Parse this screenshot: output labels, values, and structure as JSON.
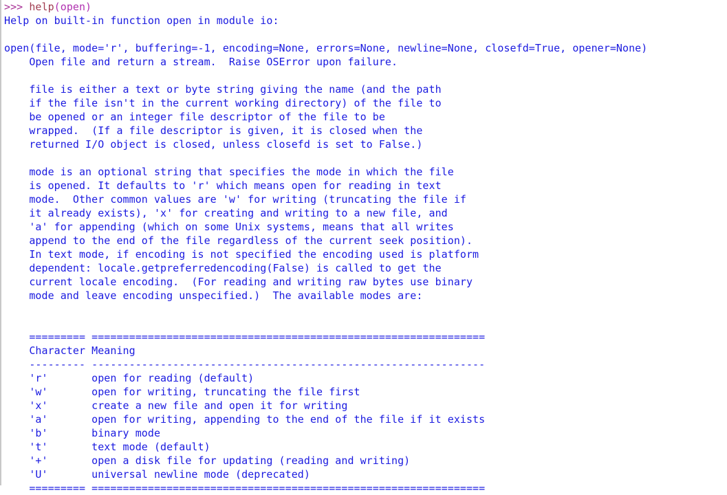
{
  "window": {
    "kind": "python-repl-console",
    "background_color": "#ffffff",
    "text_color": "#1a1ae0",
    "prompt_color": "#a83296",
    "builtin_color": "#a03c50",
    "paren_color": "#b030b0",
    "border_color": "#c8c8c8"
  },
  "prompt": {
    "marker": ">>> ",
    "command_name": "help",
    "command_args": "(open)"
  },
  "output": {
    "header": "Help on built-in function open in module io:",
    "signature": "open(file, mode='r', buffering=-1, encoding=None, errors=None, newline=None, closefd=True, opener=None)",
    "summary": "    Open file and return a stream.  Raise OSError upon failure.",
    "paragraph_file": [
      "    file is either a text or byte string giving the name (and the path",
      "    if the file isn't in the current working directory) of the file to",
      "    be opened or an integer file descriptor of the file to be",
      "    wrapped.  (If a file descriptor is given, it is closed when the",
      "    returned I/O object is closed, unless closefd is set to False.)"
    ],
    "paragraph_mode": [
      "    mode is an optional string that specifies the mode in which the file",
      "    is opened. It defaults to 'r' which means open for reading in text",
      "    mode.  Other common values are 'w' for writing (truncating the file if",
      "    it already exists), 'x' for creating and writing to a new file, and",
      "    'a' for appending (which on some Unix systems, means that all writes",
      "    append to the end of the file regardless of the current seek position).",
      "    In text mode, if encoding is not specified the encoding used is platform",
      "    dependent: locale.getpreferredencoding(False) is called to get the",
      "    current locale encoding.  (For reading and writing raw bytes use binary",
      "    mode and leave encoding unspecified.)  The available modes are:"
    ],
    "table": {
      "rule_top": "    ========= ===============================================================",
      "header_row": "    Character Meaning",
      "rule_mid": "    --------- ---------------------------------------------------------------",
      "rule_bottom": "    ========= ===============================================================",
      "columns": [
        "Character",
        "Meaning"
      ],
      "rows": [
        {
          "character": "'r'",
          "meaning": "open for reading (default)",
          "line": "    'r'       open for reading (default)"
        },
        {
          "character": "'w'",
          "meaning": "open for writing, truncating the file first",
          "line": "    'w'       open for writing, truncating the file first"
        },
        {
          "character": "'x'",
          "meaning": "create a new file and open it for writing",
          "line": "    'x'       create a new file and open it for writing"
        },
        {
          "character": "'a'",
          "meaning": "open for writing, appending to the end of the file if it exists",
          "line": "    'a'       open for writing, appending to the end of the file if it exists"
        },
        {
          "character": "'b'",
          "meaning": "binary mode",
          "line": "    'b'       binary mode"
        },
        {
          "character": "'t'",
          "meaning": "text mode (default)",
          "line": "    't'       text mode (default)"
        },
        {
          "character": "'+'",
          "meaning": "open a disk file for updating (reading and writing)",
          "line": "    '+'       open a disk file for updating (reading and writing)"
        },
        {
          "character": "'U'",
          "meaning": "universal newline mode (deprecated)",
          "line": "    'U'       universal newline mode (deprecated)"
        }
      ]
    }
  }
}
